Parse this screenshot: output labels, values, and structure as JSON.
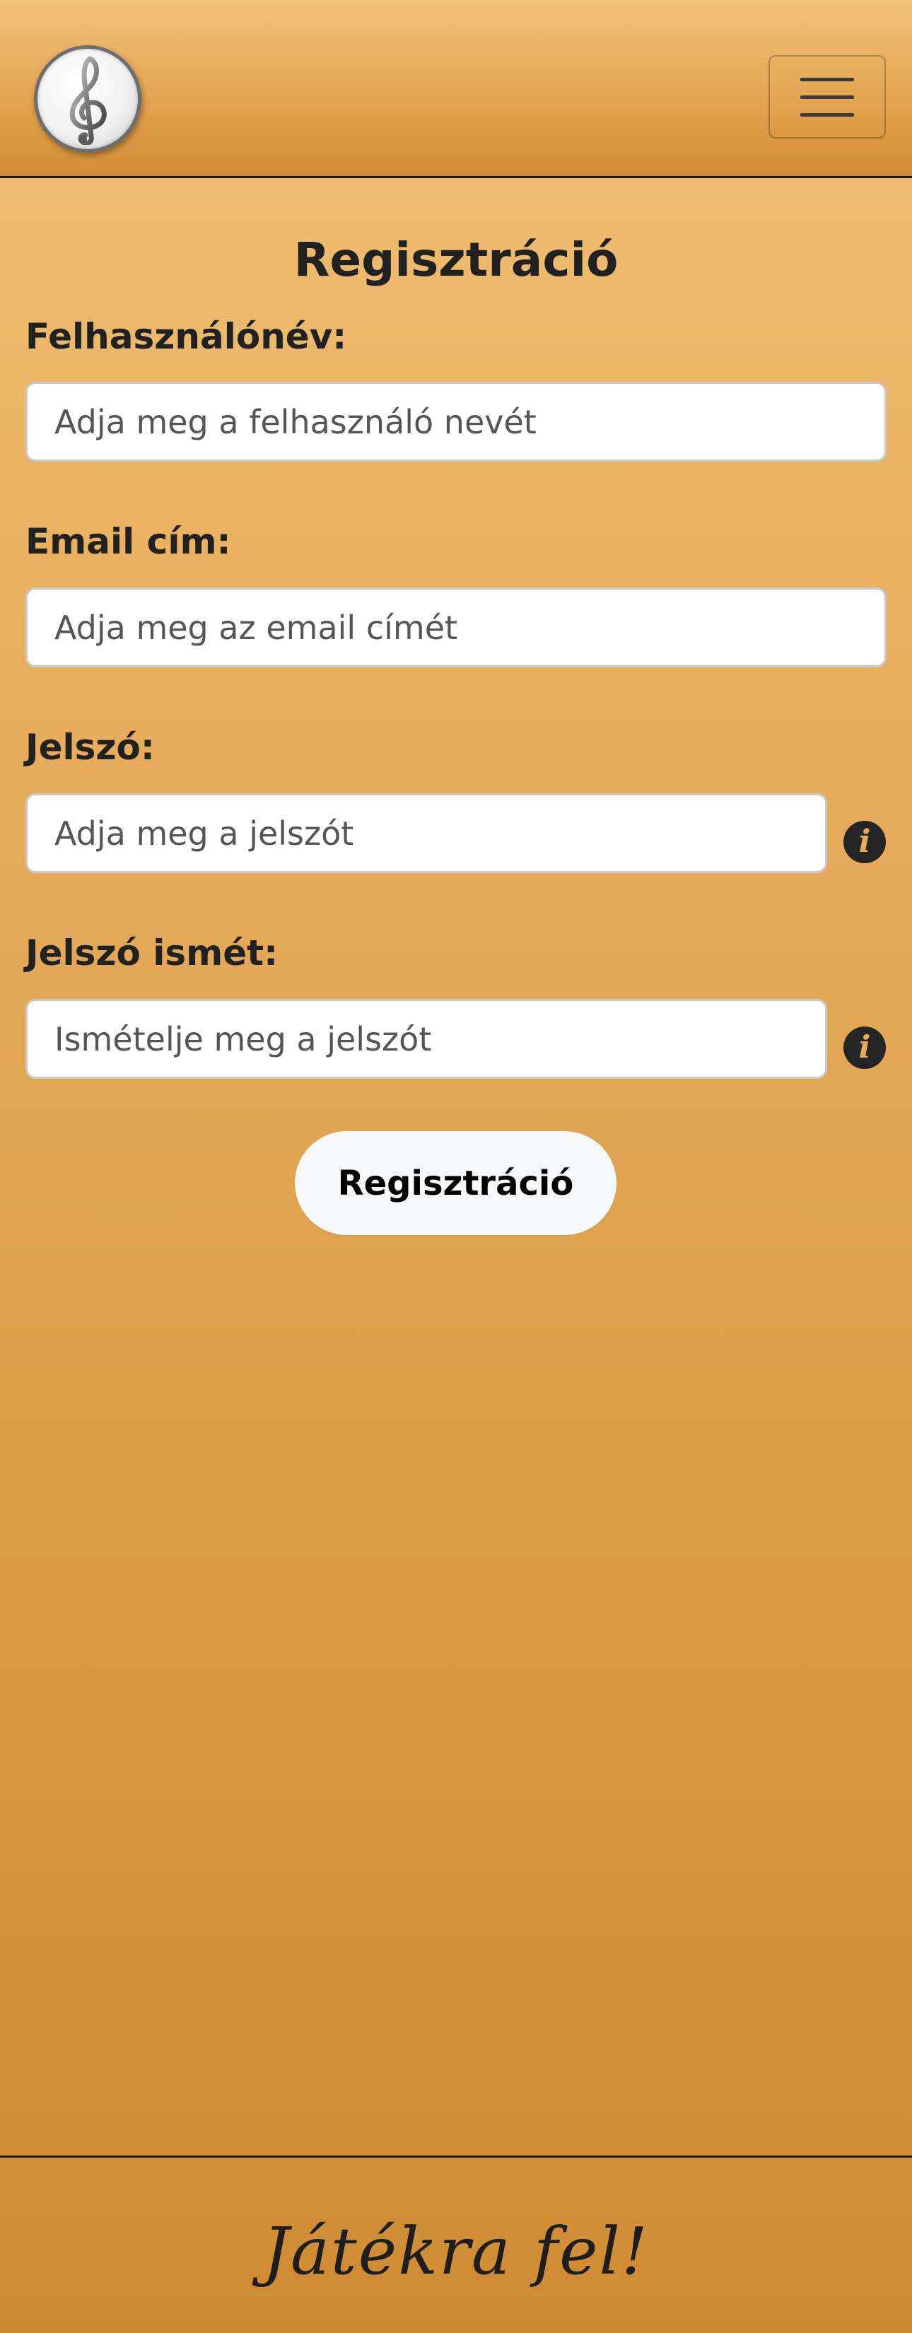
{
  "header": {
    "logo_icon": "treble-clef-icon",
    "menu_icon": "hamburger-menu-icon"
  },
  "page": {
    "title": "Regisztráció"
  },
  "form": {
    "username": {
      "label": "Felhasználónév:",
      "placeholder": "Adja meg a felhasználó nevét",
      "value": ""
    },
    "email": {
      "label": "Email cím:",
      "placeholder": "Adja meg az email címét",
      "value": ""
    },
    "password": {
      "label": "Jelszó:",
      "placeholder": "Adja meg a jelszót",
      "value": "",
      "info_glyph": "i"
    },
    "password_confirm": {
      "label": "Jelszó ismét:",
      "placeholder": "Ismételje meg a jelszót",
      "value": "",
      "info_glyph": "i"
    },
    "submit_label": "Regisztráció"
  },
  "footer": {
    "text": "Játékra fel!"
  },
  "colors": {
    "background_top": "#f1c277",
    "background_bottom": "#cf8b31",
    "text": "#212121",
    "button_bg": "#f7f8f9"
  }
}
